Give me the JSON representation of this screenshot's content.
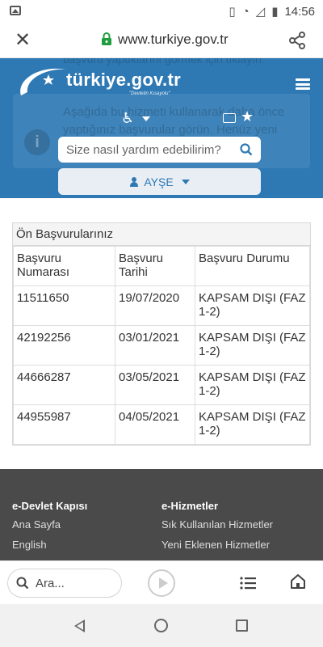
{
  "status_bar": {
    "time": "14:56"
  },
  "browser": {
    "url": "www.turkiye.gov.tr"
  },
  "header": {
    "logo_text": "türkiye.gov.tr",
    "logo_tagline": "\"Devletin Kısayolu\"",
    "ghost_line": "başvuru yaptıklarını görmek için tıklayın.",
    "ghost_text": "Aşağıda bu hizmeti kullanarak daha önce yaptığınız başvurular görün. Henüz yeni başvuru yapmadıysanız ...anda",
    "search_placeholder": "Size nasıl yardım edebilirim?",
    "user_name": "AYŞE"
  },
  "applications": {
    "title": "Ön Başvurularınız",
    "columns": [
      "Başvuru Numarası",
      "Başvuru Tarihi",
      "Başvuru Durumu"
    ],
    "rows": [
      [
        "11511650",
        "19/07/2020",
        "KAPSAM DIŞI (FAZ 1-2)"
      ],
      [
        "42192256",
        "03/01/2021",
        "KAPSAM DIŞI (FAZ 1-2)"
      ],
      [
        "44666287",
        "03/05/2021",
        "KAPSAM DIŞI (FAZ 1-2)"
      ],
      [
        "44955987",
        "04/05/2021",
        "KAPSAM DIŞI (FAZ 1-2)"
      ]
    ]
  },
  "footer": {
    "col1": {
      "heading": "e-Devlet Kapısı",
      "links": [
        "Ana Sayfa",
        "English"
      ]
    },
    "col2": {
      "heading": "e-Hizmetler",
      "links": [
        "Sık Kullanılan Hizmetler",
        "Yeni Eklenen Hizmetler"
      ]
    }
  },
  "toolbar": {
    "search_label": "Ara..."
  },
  "colors": {
    "brand_blue": "#2e79b4",
    "footer_bg": "#4a4a4a"
  }
}
